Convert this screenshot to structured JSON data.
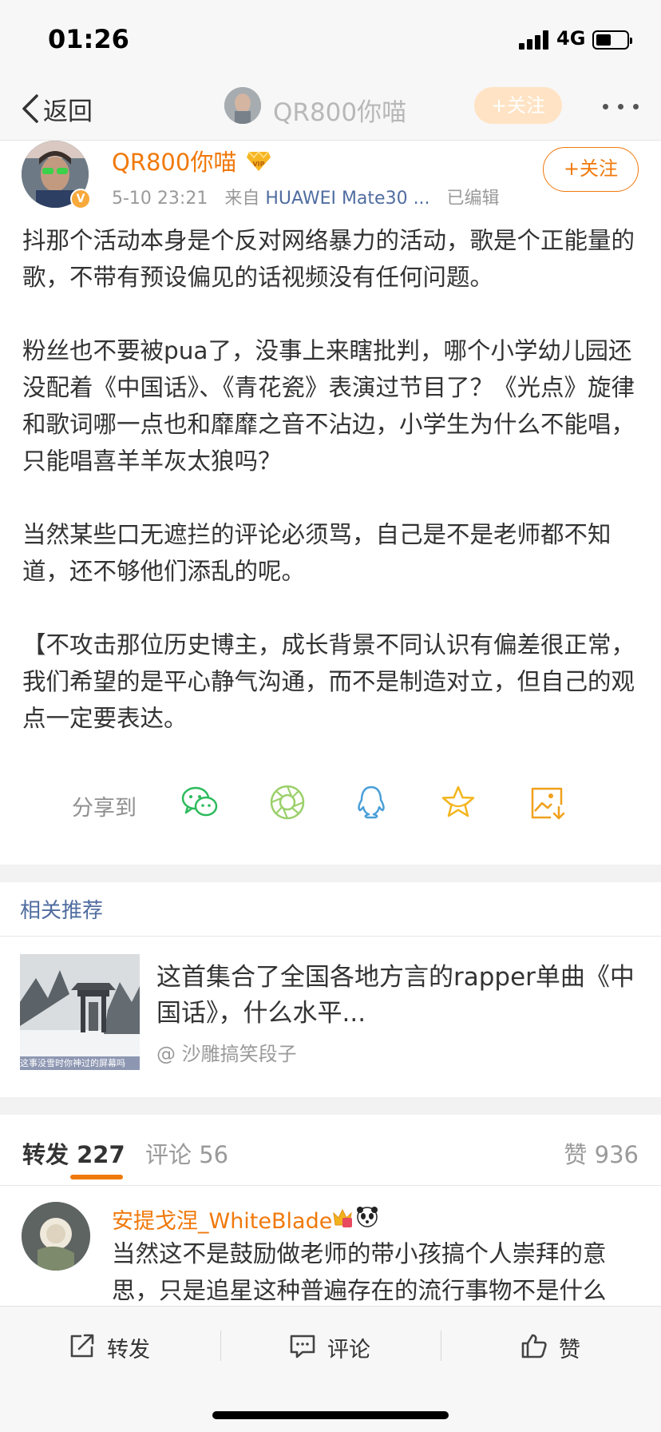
{
  "status_bar": {
    "time": "01:26",
    "network": "4G"
  },
  "nav": {
    "back_label": "返回",
    "title": "QR800你喵",
    "follow_label": "+关注"
  },
  "post": {
    "author": "QR800你喵",
    "timestamp": "5-10 23:21",
    "source_prefix": "来自",
    "device": "HUAWEI Mate30 ...",
    "edited": "已编辑",
    "follow_label": "+关注",
    "paragraphs": [
      "抖那个活动本身是个反对网络暴力的活动，歌是个正能量的歌，不带有预设偏见的话视频没有任何问题。",
      "粉丝也不要被pua了，没事上来瞎批判，哪个小学幼儿园还没配着《中国话》、《青花瓷》表演过节目了？《光点》旋律和歌词哪一点也和靡靡之音不沾边，小学生为什么不能唱，只能唱喜羊羊灰太狼吗？",
      "当然某些口无遮拦的评论必须骂，自己是不是老师都不知道，还不够他们添乱的呢。",
      "【不攻击那位历史博主，成长背景不同认识有偏差很正常，我们希望的是平心静气沟通，而不是制造对立，但自己的观点一定要表达。"
    ]
  },
  "share": {
    "label": "分享到",
    "icons": [
      "wechat-icon",
      "moments-icon",
      "qq-icon",
      "favorite-icon",
      "save-image-icon"
    ]
  },
  "related": {
    "section_title": "相关推荐",
    "item_title": "这首集合了全国各地方言的rapper单曲《中国话》，什么水平...",
    "item_source": "@ 沙雕搞笑段子",
    "thumb_caption": "这事没雪时你神过的屏幕吗"
  },
  "tabs": {
    "repost": "转发 227",
    "comment": "评论 56",
    "like": "赞 936"
  },
  "comment": {
    "author": "安提戈涅_WhiteBlade",
    "text": "当然这不是鼓励做老师的带小孩搞个人崇拜的意思，只是追星这种普遍存在的流行事物不是什么"
  },
  "bottom_bar": {
    "repost": "转发",
    "comment": "评论",
    "like": "赞"
  },
  "colors": {
    "accent": "#f0790b",
    "link": "#506da0",
    "muted": "#9a9a9a"
  }
}
